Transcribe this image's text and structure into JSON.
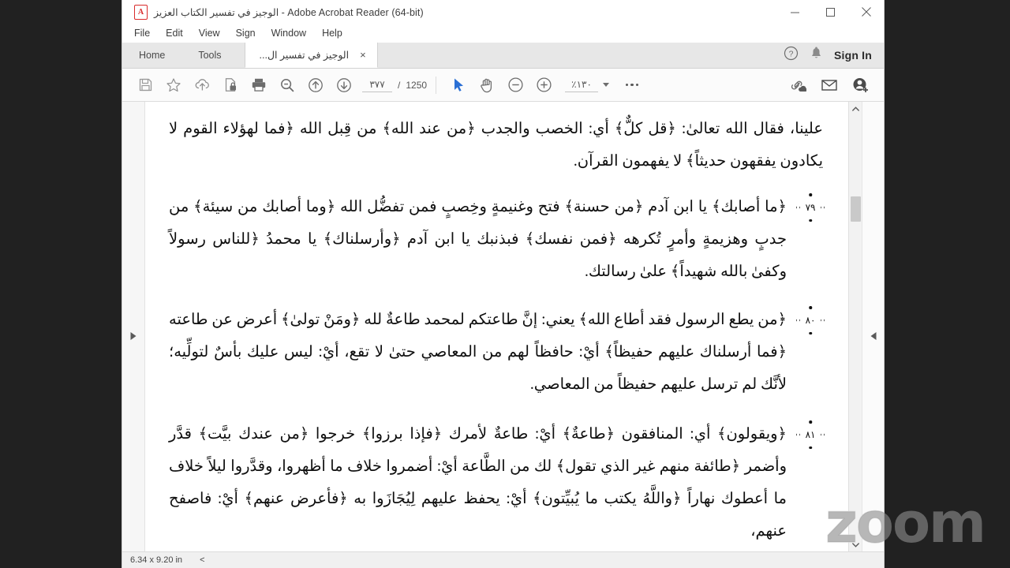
{
  "window": {
    "title": "الوجيز في تفسير الكتاب العزيز  -  Adobe Acrobat Reader (64-bit)",
    "app_icon": "pdf-logo-icon",
    "minimize_label": "minimize-icon",
    "maximize_label": "maximize-icon",
    "close_label": "close-icon"
  },
  "menubar": {
    "items": [
      "File",
      "Edit",
      "View",
      "Sign",
      "Window",
      "Help"
    ]
  },
  "tabbar": {
    "home_label": "Home",
    "tools_label": "Tools",
    "document_tab_label": "الوجيز في تفسير ال...",
    "document_tab_close": "×",
    "help_icon": "question-circle-icon",
    "bell_icon": "bell-icon",
    "signin_label": "Sign In"
  },
  "toolbar": {
    "save_icon": "save-floppy-icon",
    "star_icon": "star-icon",
    "cloud_upload_icon": "cloud-upload-icon",
    "protect_icon": "protected-document-icon",
    "print_icon": "printer-icon",
    "find_icon": "search-minus-icon",
    "prev_page_icon": "arrow-up-circle-icon",
    "next_page_icon": "arrow-down-circle-icon",
    "page_current": "٣٧٧",
    "page_separator": "/",
    "page_total": "1250",
    "select_tool_icon": "cursor-arrow-icon",
    "hand_tool_icon": "hand-icon",
    "zoom_out_icon": "zoom-out-circle-icon",
    "zoom_in_icon": "zoom-in-circle-icon",
    "zoom_level": "١٣٠٪",
    "zoom_dropdown_icon": "chevron-down-icon",
    "more_tools_icon": "ellipsis-icon",
    "share_link_icon": "share-link-cloud-icon",
    "email_icon": "envelope-icon",
    "add_person_icon": "add-person-icon"
  },
  "document": {
    "paragraphs": [
      {
        "marker": null,
        "text": "علينا، فقال الله تعالىٰ: ﴿قل كلٌّ﴾ أي: الخصب والجدب ﴿من عند الله﴾ من قِبل الله ﴿فما لهؤلاء القوم لا يكادون يفقهون حديثاً﴾ لا يفهمون القرآن."
      },
      {
        "marker": "٧٩",
        "text": "﴿ما أصابك﴾ يا ابن آدم ﴿من حسنة﴾ فتح وغنيمةٍ وخِصبٍ فمن تفضُّل الله ﴿وما أصابك من سيئة﴾ من جدبٍ وهزيمةٍ وأمرٍ تُكرهه ﴿فمن نفسك﴾ فبذنبك يا ابن آدم ﴿وأرسلناك﴾ يا محمدُ ﴿للناس رسولاً وكفىٰ بالله شهيداً﴾ علىٰ رسالتك."
      },
      {
        "marker": "٨٠",
        "text": "﴿من يطع الرسول فقد أطاع الله﴾ يعني: إنَّ طاعتكم لمحمد طاعةٌ لله ﴿ومَنْ تولىٰ﴾ أعرض عن طاعته ﴿فما أرسلناك عليهم حفيظاً﴾ أيْ: حافظاً لهم من المعاصي حتىٰ لا تقع، أيْ: ليس عليك بأسٌ لتولِّيه؛ لأنَّك لم ترسل عليهم حفيظاً من المعاصي."
      },
      {
        "marker": "٨١",
        "text": "﴿ويقولون﴾ أي: المنافقون ﴿طاعةٌ﴾ أيْ: طاعةٌ لأمرك ﴿فإذا برزوا﴾ خرجوا ﴿من عندك بيَّت﴾ قدَّر وأضمر ﴿طائفة منهم غير الذي تقول﴾ لك من الطَّاعة أيْ: أضمروا خلاف ما أظهروا، وقدَّروا ليلاً خلاف ما أعطوك نهاراً ﴿واللَّهُ يكتب ما يُبيِّتون﴾ أيْ: يحفظ عليهم لِيُجَازَوا به ﴿فأعرض عنهم﴾ أيْ: فاصفح عنهم،"
      }
    ]
  },
  "scrollbar": {
    "up_arrow_icon": "chevron-up-icon",
    "down_arrow_icon": "chevron-down-icon",
    "thumb": "scroll-thumb"
  },
  "rails": {
    "left_expand_icon": "expand-right-arrow-icon",
    "right_expand_icon": "expand-left-arrow-icon"
  },
  "statusbar": {
    "page_dimensions": "6.34 x 9.20 in",
    "collapse_icon": "<"
  },
  "watermark": {
    "text": "zoom"
  },
  "colors": {
    "background": "#212121",
    "window": "#ffffff",
    "tabbar": "#e7e7e7",
    "toolbar": "#fbfbfb",
    "accent": "#2a6fd4",
    "pdf_red": "#d92b2b"
  }
}
